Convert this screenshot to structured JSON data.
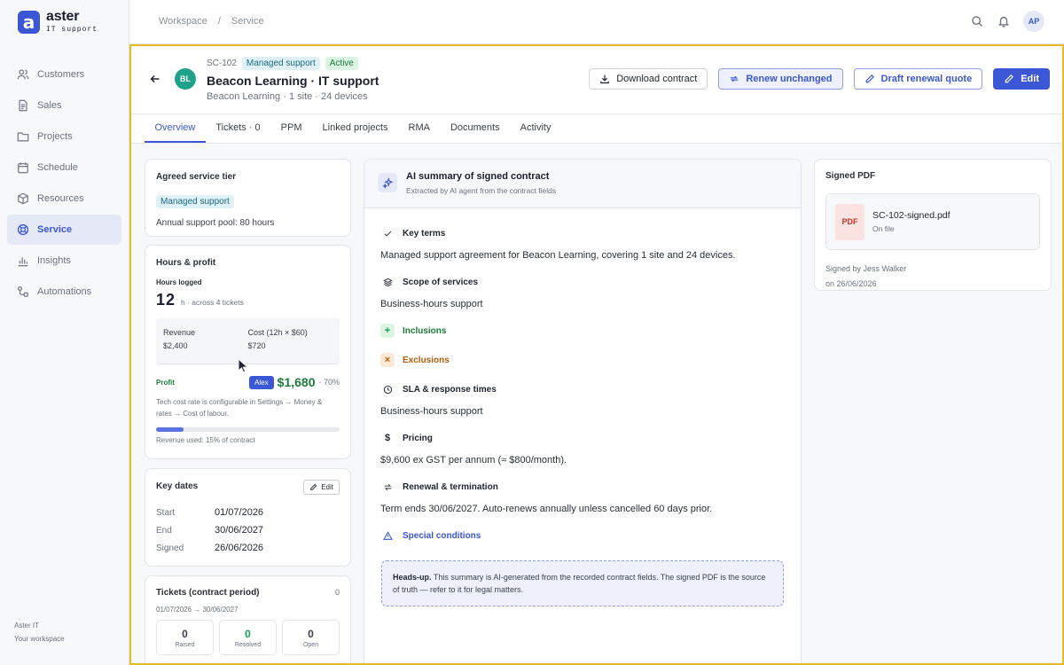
{
  "app": {
    "logo_letter": "a",
    "name": "aster",
    "subtitle": "IT support"
  },
  "sidebar": {
    "items": [
      {
        "label": "Customers",
        "icon": "users-icon"
      },
      {
        "label": "Sales",
        "icon": "document-icon"
      },
      {
        "label": "Projects",
        "icon": "folder-icon"
      },
      {
        "label": "Schedule",
        "icon": "calendar-icon"
      },
      {
        "label": "Resources",
        "icon": "box-icon"
      },
      {
        "label": "Service",
        "icon": "lifebuoy-icon",
        "active": true
      },
      {
        "label": "Insights",
        "icon": "bar-chart-icon"
      },
      {
        "label": "Automations",
        "icon": "flow-icon"
      }
    ],
    "footer_line1": "Aster IT",
    "footer_line2": "Your workspace"
  },
  "topbar": {
    "crumb1": "Workspace",
    "separator": "/",
    "crumb2": "Service",
    "avatar": "AP"
  },
  "contract": {
    "id": "SC-102",
    "tier_badge": "Managed support",
    "status_badge": "Active",
    "client_initials": "BL",
    "title": "Beacon Learning · IT support",
    "subtitle": "Beacon Learning · 1 site · 24 devices"
  },
  "actions": {
    "download": "Download contract",
    "renew": "Renew unchanged",
    "draft": "Draft renewal quote",
    "edit": "Edit"
  },
  "tabs": [
    "Overview",
    "Tickets · 0",
    "PPM",
    "Linked projects",
    "RMA",
    "Documents",
    "Activity"
  ],
  "tier_card": {
    "title": "Agreed service tier",
    "badge": "Managed support",
    "pool": "Annual support pool: 80 hours"
  },
  "hours_card": {
    "title": "Hours & profit",
    "logged_label": "Hours logged",
    "logged_value": "12",
    "logged_unit": "h · across 4 tickets",
    "revenue_label": "Revenue",
    "revenue_value": "$2,400",
    "cost_label": "Cost (12h × $60)",
    "cost_value": "$720",
    "profit_label": "Profit",
    "cursor_user": "Alex",
    "profit_value": "$1,680",
    "profit_pct": "· 70%",
    "note": "Tech cost rate is configurable in Settings → Money & rates → Cost of labour.",
    "revenue_used_fraction": 0.15,
    "revenue_used_caption": "Revenue used: 15% of contract"
  },
  "dates_card": {
    "title": "Key dates",
    "edit_label": "Edit",
    "rows": [
      {
        "label": "Start",
        "value": "01/07/2026"
      },
      {
        "label": "End",
        "value": "30/06/2027"
      },
      {
        "label": "Signed",
        "value": "26/06/2026"
      }
    ]
  },
  "tickets_card": {
    "title": "Tickets (contract period)",
    "count": "0",
    "period": "01/07/2026 → 30/06/2027",
    "stats": [
      {
        "value": "0",
        "label": "Raised"
      },
      {
        "value": "0",
        "label": "Resolved"
      },
      {
        "value": "0",
        "label": "Open"
      }
    ]
  },
  "ai_summary": {
    "title": "AI summary of signed contract",
    "subtitle": "Extracted by AI agent from the contract fields",
    "key_terms_label": "Key terms",
    "key_terms_text": "Managed support agreement for Beacon Learning, covering 1 site and 24 devices.",
    "scope_label": "Scope of services",
    "scope_text": "Business-hours support",
    "inclusions_label": "Inclusions",
    "exclusions_label": "Exclusions",
    "sla_label": "SLA & response times",
    "sla_text": "Business-hours support",
    "pricing_label": "Pricing",
    "pricing_symbol": "$",
    "pricing_text": "$9,600 ex GST per annum (≈ $800/month).",
    "renewal_label": "Renewal & termination",
    "renewal_text": "Term ends 30/06/2027. Auto-renews annually unless cancelled 60 days prior.",
    "special_label": "Special conditions",
    "headsup_bold": "Heads-up.",
    "headsup_text": " This summary is AI-generated from the recorded contract fields. The signed PDF is the source of truth — refer to it for legal matters."
  },
  "pdf_card": {
    "title": "Signed PDF",
    "icon_text": "PDF",
    "file_name": "SC-102-signed.pdf",
    "file_status": "On file",
    "signed_by": "Signed by Jess Walker",
    "signed_on": "on 26/06/2026"
  },
  "colors": {
    "accent": "#3b57d6",
    "frame": "#e6b927",
    "success": "#1a7a3a"
  }
}
